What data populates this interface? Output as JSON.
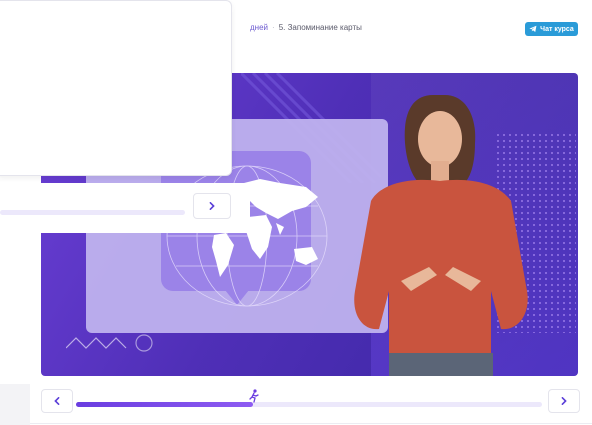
{
  "breadcrumb": {
    "prev_link": "дней",
    "separator": "·",
    "current": "5. Запоминание карты"
  },
  "chat_button": {
    "label": "Чат курса",
    "icon": "telegram-plane-icon"
  },
  "player": {
    "progress_fraction": 0.38,
    "prev_icon": "chevron-left-icon",
    "next_icon": "chevron-right-icon",
    "position_marker_icon": "runner-icon"
  },
  "colors": {
    "accent": "#6a3de0",
    "chat_button": "#2a9bd8",
    "video_bg": "#4f2fb7"
  }
}
